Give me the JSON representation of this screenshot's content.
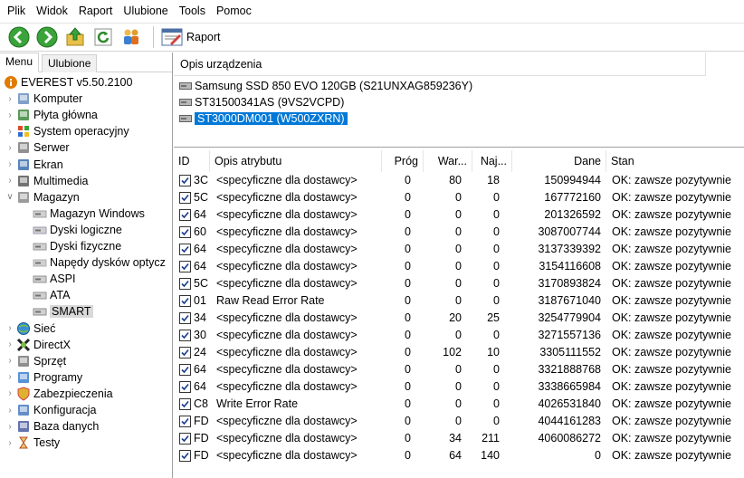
{
  "menubar": [
    "Plik",
    "Widok",
    "Raport",
    "Ulubione",
    "Tools",
    "Pomoc"
  ],
  "toolbar": {
    "raport_label": "Raport",
    "icons": [
      "back-icon",
      "forward-icon",
      "up-folder-icon",
      "refresh-icon",
      "users-icon",
      "report-icon"
    ]
  },
  "left": {
    "tabs": [
      "Menu",
      "Ulubione"
    ],
    "tree": [
      {
        "label": "EVEREST v5.50.2100",
        "icon": "info-icon",
        "indent": 0,
        "expander": ""
      },
      {
        "label": "Komputer",
        "icon": "computer-icon",
        "indent": 1,
        "expander": ">"
      },
      {
        "label": "Płyta główna",
        "icon": "motherboard-icon",
        "indent": 1,
        "expander": ">"
      },
      {
        "label": "System operacyjny",
        "icon": "windows-icon",
        "indent": 1,
        "expander": ">"
      },
      {
        "label": "Serwer",
        "icon": "server-icon",
        "indent": 1,
        "expander": ">"
      },
      {
        "label": "Ekran",
        "icon": "monitor-icon",
        "indent": 1,
        "expander": ">"
      },
      {
        "label": "Multimedia",
        "icon": "speaker-icon",
        "indent": 1,
        "expander": ">"
      },
      {
        "label": "Magazyn",
        "icon": "storage-icon",
        "indent": 1,
        "expander": "v"
      },
      {
        "label": "Magazyn Windows",
        "icon": "drive-icon",
        "indent": 2,
        "expander": ""
      },
      {
        "label": "Dyski logiczne",
        "icon": "logical-disk-icon",
        "indent": 2,
        "expander": ""
      },
      {
        "label": "Dyski fizyczne",
        "icon": "physical-disk-icon",
        "indent": 2,
        "expander": ""
      },
      {
        "label": "Napędy dysków optycz",
        "icon": "optical-drive-icon",
        "indent": 2,
        "expander": ""
      },
      {
        "label": "ASPI",
        "icon": "aspi-icon",
        "indent": 2,
        "expander": ""
      },
      {
        "label": "ATA",
        "icon": "ata-icon",
        "indent": 2,
        "expander": ""
      },
      {
        "label": "SMART",
        "icon": "smart-disk-icon",
        "indent": 2,
        "expander": "",
        "selected": true
      },
      {
        "label": "Sieć",
        "icon": "network-icon",
        "indent": 1,
        "expander": ">"
      },
      {
        "label": "DirectX",
        "icon": "directx-icon",
        "indent": 1,
        "expander": ">"
      },
      {
        "label": "Sprzęt",
        "icon": "hardware-icon",
        "indent": 1,
        "expander": ">"
      },
      {
        "label": "Programy",
        "icon": "programs-icon",
        "indent": 1,
        "expander": ">"
      },
      {
        "label": "Zabezpieczenia",
        "icon": "shield-icon",
        "indent": 1,
        "expander": ">"
      },
      {
        "label": "Konfiguracja",
        "icon": "config-icon",
        "indent": 1,
        "expander": ">"
      },
      {
        "label": "Baza danych",
        "icon": "database-icon",
        "indent": 1,
        "expander": ">"
      },
      {
        "label": "Testy",
        "icon": "hourglass-icon",
        "indent": 1,
        "expander": ">"
      }
    ]
  },
  "devices": {
    "header": "Opis urządzenia",
    "items": [
      {
        "label": "Samsung SSD 850 EVO 120GB (S21UNXAG859236Y)",
        "selected": false
      },
      {
        "label": "ST31500341AS (9VS2VCPD)",
        "selected": false
      },
      {
        "label": "ST3000DM001 (W500ZXRN)",
        "selected": true
      }
    ]
  },
  "table": {
    "columns": [
      "ID",
      "Opis atrybutu",
      "Próg",
      "War...",
      "Naj...",
      "Dane",
      "Stan"
    ],
    "rows": [
      {
        "id": "3C",
        "desc": "<specyficzne dla dostawcy>",
        "prog": "0",
        "war": "80",
        "naj": "18",
        "dane": "150994944",
        "stan": "OK: zawsze pozytywnie"
      },
      {
        "id": "5C",
        "desc": "<specyficzne dla dostawcy>",
        "prog": "0",
        "war": "0",
        "naj": "0",
        "dane": "167772160",
        "stan": "OK: zawsze pozytywnie"
      },
      {
        "id": "64",
        "desc": "<specyficzne dla dostawcy>",
        "prog": "0",
        "war": "0",
        "naj": "0",
        "dane": "201326592",
        "stan": "OK: zawsze pozytywnie"
      },
      {
        "id": "60",
        "desc": "<specyficzne dla dostawcy>",
        "prog": "0",
        "war": "0",
        "naj": "0",
        "dane": "3087007744",
        "stan": "OK: zawsze pozytywnie"
      },
      {
        "id": "64",
        "desc": "<specyficzne dla dostawcy>",
        "prog": "0",
        "war": "0",
        "naj": "0",
        "dane": "3137339392",
        "stan": "OK: zawsze pozytywnie"
      },
      {
        "id": "64",
        "desc": "<specyficzne dla dostawcy>",
        "prog": "0",
        "war": "0",
        "naj": "0",
        "dane": "3154116608",
        "stan": "OK: zawsze pozytywnie"
      },
      {
        "id": "5C",
        "desc": "<specyficzne dla dostawcy>",
        "prog": "0",
        "war": "0",
        "naj": "0",
        "dane": "3170893824",
        "stan": "OK: zawsze pozytywnie"
      },
      {
        "id": "01",
        "desc": "Raw Read Error Rate",
        "prog": "0",
        "war": "0",
        "naj": "0",
        "dane": "3187671040",
        "stan": "OK: zawsze pozytywnie"
      },
      {
        "id": "34",
        "desc": "<specyficzne dla dostawcy>",
        "prog": "0",
        "war": "20",
        "naj": "25",
        "dane": "3254779904",
        "stan": "OK: zawsze pozytywnie"
      },
      {
        "id": "30",
        "desc": "<specyficzne dla dostawcy>",
        "prog": "0",
        "war": "0",
        "naj": "0",
        "dane": "3271557136",
        "stan": "OK: zawsze pozytywnie"
      },
      {
        "id": "24",
        "desc": "<specyficzne dla dostawcy>",
        "prog": "0",
        "war": "102",
        "naj": "10",
        "dane": "3305111552",
        "stan": "OK: zawsze pozytywnie"
      },
      {
        "id": "64",
        "desc": "<specyficzne dla dostawcy>",
        "prog": "0",
        "war": "0",
        "naj": "0",
        "dane": "3321888768",
        "stan": "OK: zawsze pozytywnie"
      },
      {
        "id": "64",
        "desc": "<specyficzne dla dostawcy>",
        "prog": "0",
        "war": "0",
        "naj": "0",
        "dane": "3338665984",
        "stan": "OK: zawsze pozytywnie"
      },
      {
        "id": "C8",
        "desc": "Write Error Rate",
        "prog": "0",
        "war": "0",
        "naj": "0",
        "dane": "4026531840",
        "stan": "OK: zawsze pozytywnie"
      },
      {
        "id": "FD",
        "desc": "<specyficzne dla dostawcy>",
        "prog": "0",
        "war": "0",
        "naj": "0",
        "dane": "4044161283",
        "stan": "OK: zawsze pozytywnie"
      },
      {
        "id": "FD",
        "desc": "<specyficzne dla dostawcy>",
        "prog": "0",
        "war": "34",
        "naj": "211",
        "dane": "4060086272",
        "stan": "OK: zawsze pozytywnie"
      },
      {
        "id": "FD",
        "desc": "<specyficzne dla dostawcy>",
        "prog": "0",
        "war": "64",
        "naj": "140",
        "dane": "0",
        "stan": "OK: zawsze pozytywnie"
      }
    ]
  },
  "colors": {
    "selection": "#0078d7",
    "tree_selection": "#d9d9d9",
    "checkbox_tick": "#1a3c8c"
  }
}
